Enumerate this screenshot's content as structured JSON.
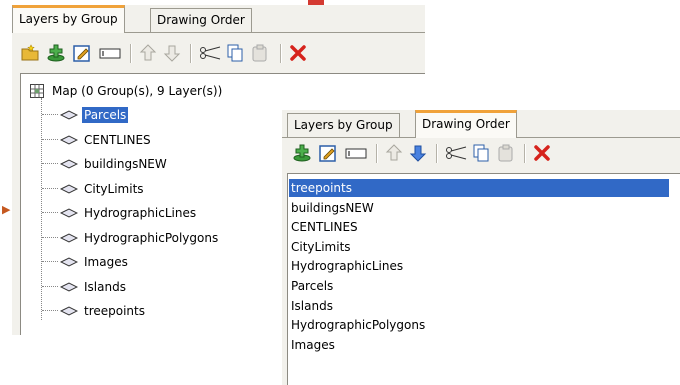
{
  "panel_main": {
    "tabs": [
      {
        "label": "Layers by Group"
      },
      {
        "label": "Drawing Order"
      }
    ],
    "toolbar": [
      "new-group-icon",
      "add-layer-icon",
      "edit-properties-icon",
      "rename-icon",
      "move-up-icon",
      "move-down-icon",
      "cut-icon",
      "copy-icon",
      "paste-icon",
      "delete-icon"
    ],
    "map_label": "Map (0 Group(s), 9 Layer(s))",
    "layers": [
      "Parcels",
      "CENTLINES",
      "buildingsNEW",
      "CityLimits",
      "HydrographicLines",
      "HydrographicPolygons",
      "Images",
      "Islands",
      "treepoints"
    ],
    "selected_index": 0
  },
  "panel_overlay": {
    "tabs": [
      {
        "label": "Layers by Group"
      },
      {
        "label": "Drawing Order"
      }
    ],
    "toolbar": [
      "add-layer-icon",
      "edit-properties-icon",
      "rename-icon",
      "move-up-icon",
      "move-down-icon",
      "cut-icon",
      "copy-icon",
      "paste-icon",
      "delete-icon"
    ],
    "layers": [
      "treepoints",
      "buildingsNEW",
      "CENTLINES",
      "CityLimits",
      "HydrographicLines",
      "Parcels",
      "Islands",
      "HydrographicPolygons",
      "Images"
    ],
    "selected_index": 0
  },
  "colors": {
    "selection": "#3169c6",
    "active_tab_accent": "#f0a23a",
    "delete": "#d6231c"
  }
}
